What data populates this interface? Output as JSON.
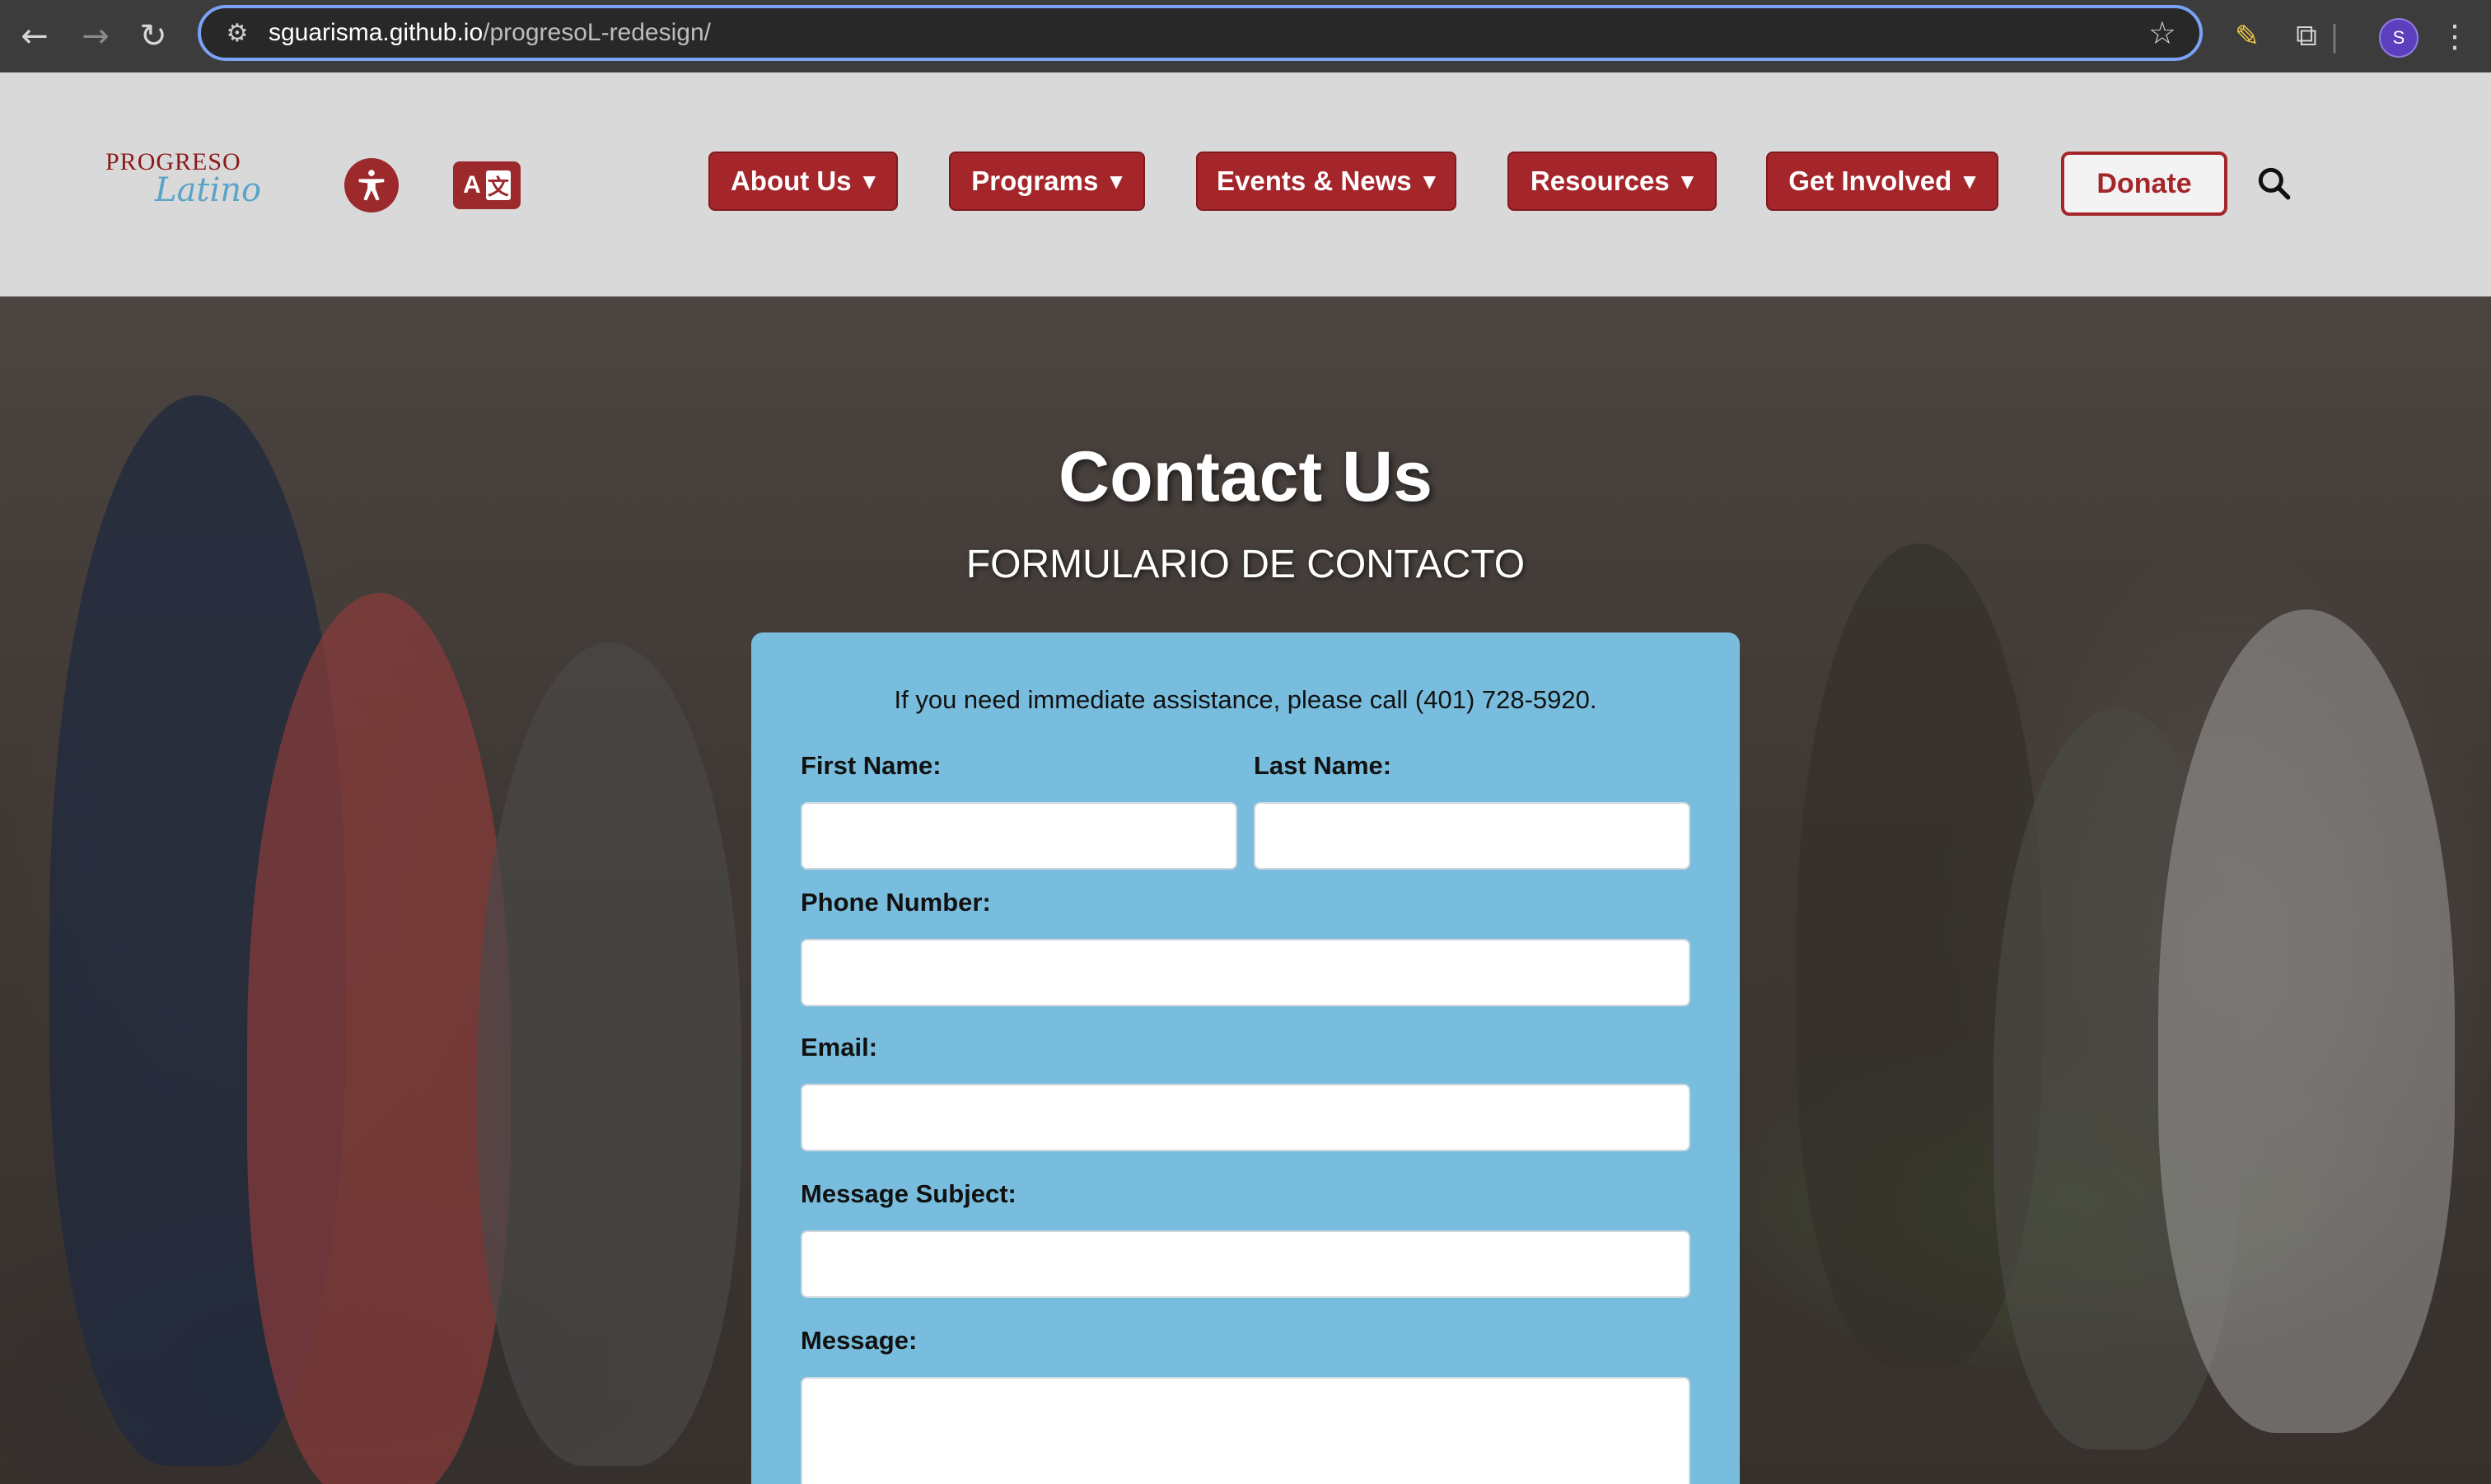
{
  "browser": {
    "url_host": "sguarisma.github.io",
    "url_path": "/progresoL-redesign/",
    "profile_initial": "S"
  },
  "logo": {
    "line1": "PROGRESO",
    "line2": "Latino"
  },
  "translate": {
    "letter": "A",
    "glyph": "文"
  },
  "nav": {
    "items": [
      {
        "label": "About Us"
      },
      {
        "label": "Programs"
      },
      {
        "label": "Events & News"
      },
      {
        "label": "Resources"
      },
      {
        "label": "Get Involved"
      }
    ],
    "donate_label": "Donate"
  },
  "hero": {
    "title": "Contact Us",
    "subtitle": "FORMULARIO DE CONTACTO"
  },
  "form": {
    "assist_text": "If you need immediate assistance, please call (401) 728-5920.",
    "first_name_label": "First Name:",
    "last_name_label": "Last Name:",
    "phone_label": "Phone Number:",
    "email_label": "Email:",
    "subject_label": "Message Subject:",
    "message_label": "Message:",
    "first_name_value": "",
    "last_name_value": "",
    "phone_value": "",
    "email_value": "",
    "subject_value": "",
    "message_value": ""
  },
  "colors": {
    "brand_red": "#a4262b",
    "form_blue": "#78bddd",
    "header_gray": "#d9d9d9"
  },
  "icons": {
    "back": "arrow-left-icon",
    "forward": "arrow-right-icon",
    "reload": "reload-icon",
    "site_settings": "tune-icon",
    "bookmark": "star-icon",
    "extension_pencil": "pencil-icon",
    "extensions": "puzzle-icon",
    "menu": "kebab-menu-icon",
    "accessibility": "accessibility-icon",
    "translate": "translate-icon",
    "search": "search-icon"
  }
}
